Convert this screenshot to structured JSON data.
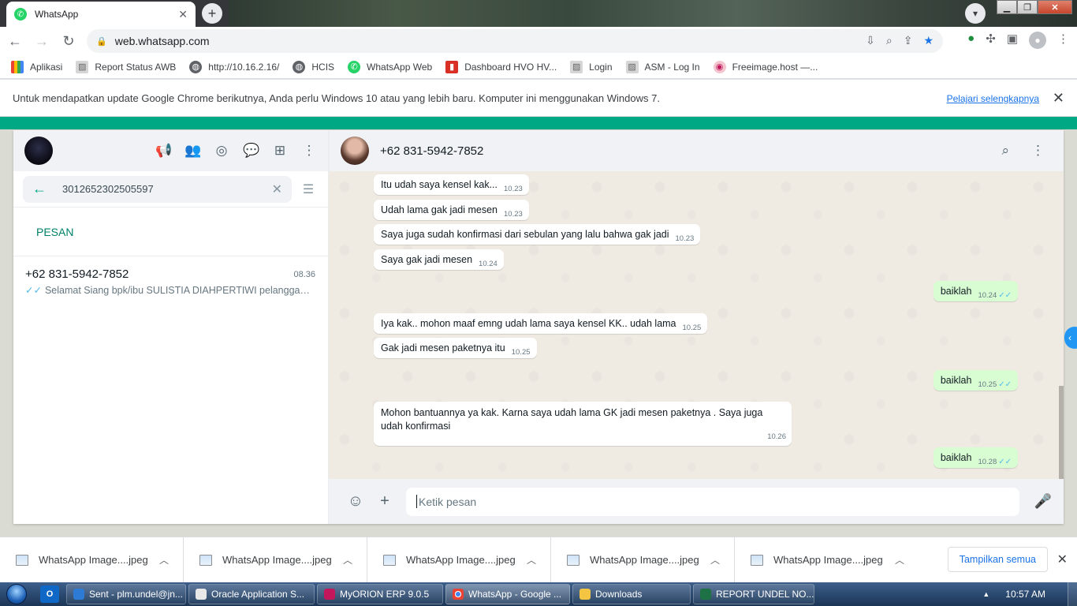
{
  "browser": {
    "tab_title": "WhatsApp",
    "url": "web.whatsapp.com",
    "bookmarks": [
      "Aplikasi",
      "Report Status AWB",
      "http://10.16.2.16/",
      "HCIS",
      "WhatsApp Web",
      "Dashboard HVO HV...",
      "Login",
      "ASM - Log In",
      "Freeimage.host —..."
    ],
    "infobar_text": "Untuk mendapatkan update Google Chrome berikutnya, Anda perlu Windows 10 atau yang lebih baru. Komputer ini menggunakan Windows 7.",
    "infobar_link": "Pelajari selengkapnya"
  },
  "sidebar": {
    "search_query": "3012652302505597",
    "section_title": "PESAN",
    "result": {
      "name": "+62 831-5942-7852",
      "time": "08.36",
      "preview": "Selamat Siang   bpk/ibu SULISTIA DIAHPERTIWI pelanggan s..."
    }
  },
  "chat": {
    "contact_name": "+62 831-5942-7852",
    "messages": [
      {
        "dir": "in",
        "text": "Itu udah saya kensel kak...",
        "time": "10.23"
      },
      {
        "dir": "in",
        "text": "Udah lama gak jadi mesen",
        "time": "10.23"
      },
      {
        "dir": "in",
        "text": "Saya juga sudah konfirmasi dari sebulan yang lalu bahwa gak jadi",
        "time": "10.23"
      },
      {
        "dir": "in",
        "text": "Saya gak jadi mesen",
        "time": "10.24"
      },
      {
        "dir": "out",
        "text": "baiklah",
        "time": "10.24"
      },
      {
        "dir": "in",
        "text": "Iya kak.. mohon maaf emng udah lama saya kensel KK.. udah lama",
        "time": "10.25"
      },
      {
        "dir": "in",
        "text": "Gak jadi mesen paketnya itu",
        "time": "10.25"
      },
      {
        "dir": "out",
        "text": "baiklah",
        "time": "10.25"
      },
      {
        "dir": "in",
        "text": "Mohon bantuannya ya kak. Karna saya udah lama GK jadi mesen paketnya . Saya juga udah konfirmasi",
        "time": "10.26"
      },
      {
        "dir": "out",
        "text": "baiklah",
        "time": "10.28"
      }
    ],
    "composer_placeholder": "Ketik pesan"
  },
  "downloads": {
    "items": [
      "WhatsApp Image....jpeg",
      "WhatsApp Image....jpeg",
      "WhatsApp Image....jpeg",
      "WhatsApp Image....jpeg",
      "WhatsApp Image....jpeg"
    ],
    "show_all": "Tampilkan semua"
  },
  "taskbar": {
    "tasks": [
      "Sent - plm.undel@jn...",
      "Oracle Application S...",
      "MyORION ERP 9.0.5",
      "WhatsApp - Google ...",
      "Downloads",
      "REPORT UNDEL NO..."
    ],
    "clock": "10:57 AM"
  },
  "colors": {
    "wa_green": "#00a884",
    "outgoing_bubble": "#d9fdd3",
    "read_tick": "#53bdeb",
    "chrome_blue": "#1a73e8"
  },
  "icons": {
    "composer": [
      "emoji-icon",
      "attach-icon",
      "mic-icon"
    ],
    "header": [
      "search-icon",
      "menu-icon"
    ]
  }
}
